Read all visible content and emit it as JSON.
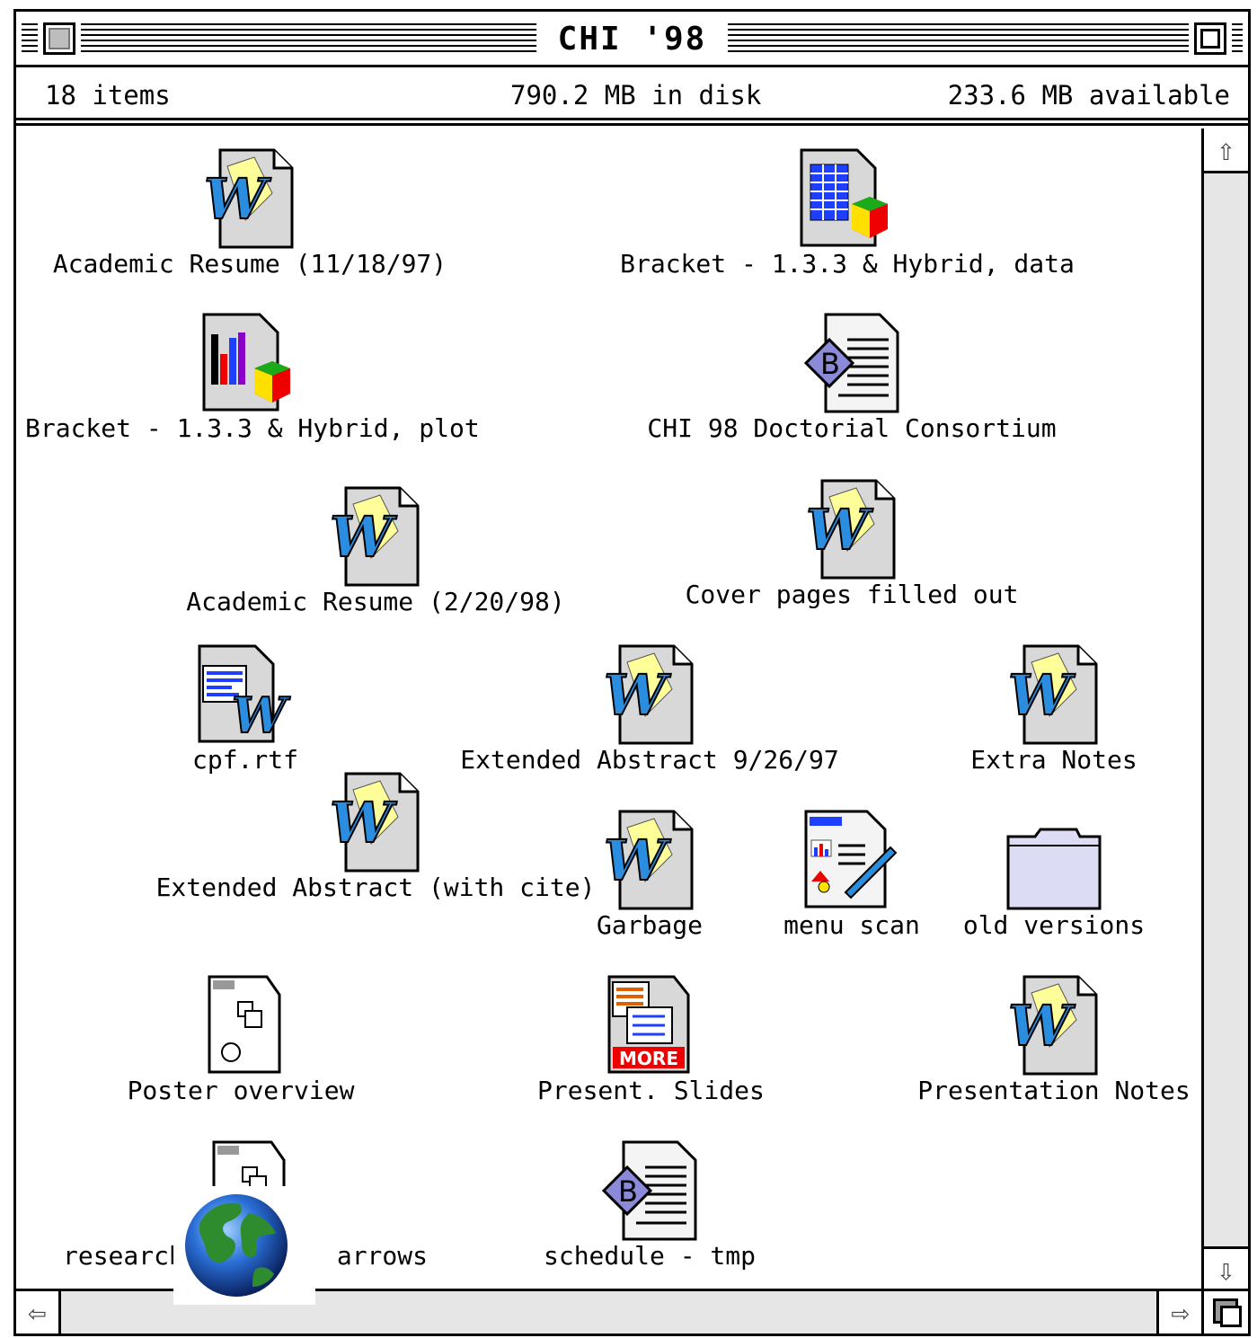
{
  "window": {
    "title": "CHI '98"
  },
  "info": {
    "items": "18 items",
    "disk": "790.2 MB in disk",
    "available": "233.6 MB available"
  },
  "files": [
    {
      "label": "Academic Resume (11/18/97)",
      "icon": "word-document-icon"
    },
    {
      "label": "Bracket - 1.3.3 & Hybrid, data",
      "icon": "spreadsheet-icon"
    },
    {
      "label": "Bracket - 1.3.3 & Hybrid, plot",
      "icon": "chart-document-icon"
    },
    {
      "label": "CHI 98 Doctorial Consortium",
      "icon": "bbedit-document-icon"
    },
    {
      "label": "Academic Resume (2/20/98)",
      "icon": "word-document-icon"
    },
    {
      "label": "Cover pages filled out",
      "icon": "word-document-icon"
    },
    {
      "label": "cpf.rtf",
      "icon": "rtf-document-icon"
    },
    {
      "label": "Extended Abstract 9/26/97",
      "icon": "word-document-icon"
    },
    {
      "label": "Extra Notes",
      "icon": "word-document-icon"
    },
    {
      "label": "Extended Abstract (with cite)",
      "icon": "word-document-icon"
    },
    {
      "label": "Garbage",
      "icon": "word-document-icon"
    },
    {
      "label": "menu scan",
      "icon": "image-document-icon"
    },
    {
      "label": "old versions",
      "icon": "folder-icon"
    },
    {
      "label": "Poster overview",
      "icon": "drawing-document-icon"
    },
    {
      "label": "Present. Slides",
      "icon": "more-document-icon"
    },
    {
      "label": "Presentation Notes",
      "icon": "word-document-icon"
    },
    {
      "label": "research",
      "label2": "arrows",
      "icon": "drawing-document-icon"
    },
    {
      "label": "schedule - tmp",
      "icon": "bbedit-document-icon"
    }
  ],
  "overlay": {
    "icon": "globe-icon"
  }
}
